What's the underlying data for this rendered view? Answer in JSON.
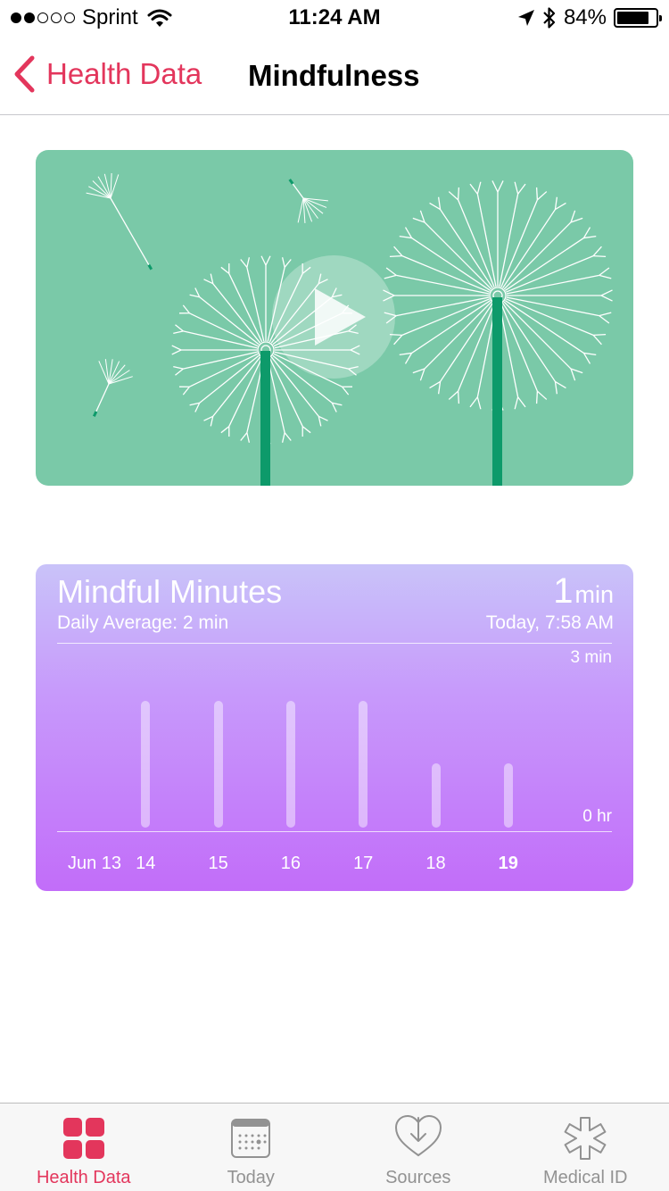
{
  "status_bar": {
    "carrier": "Sprint",
    "time": "11:24 AM",
    "battery": "84%",
    "battery_level": 0.84,
    "signal_filled": 2,
    "signal_total": 5
  },
  "nav": {
    "back_label": "Health Data",
    "title": "Mindfulness"
  },
  "colors": {
    "accent": "#e3365c",
    "video_bg": "#7ac9a8",
    "stem": "#0d9a6a"
  },
  "chart_card": {
    "title": "Mindful Minutes",
    "subtitle": "Daily Average: 2 min",
    "latest_value": "1",
    "latest_unit": "min",
    "latest_time": "Today, 7:58 AM"
  },
  "chart_data": {
    "type": "bar",
    "categories": [
      "Jun 13",
      "14",
      "15",
      "16",
      "17",
      "18",
      "19"
    ],
    "values": [
      0,
      2,
      2,
      2,
      2,
      1,
      1
    ],
    "y_max_label": "3 min",
    "y_min_label": "0 hr",
    "ylim": [
      0,
      3
    ],
    "highlighted_category": "19"
  },
  "tabs": [
    {
      "label": "Health Data",
      "icon": "health-data-icon",
      "active": true
    },
    {
      "label": "Today",
      "icon": "calendar-icon",
      "active": false
    },
    {
      "label": "Sources",
      "icon": "sources-heart-icon",
      "active": false
    },
    {
      "label": "Medical ID",
      "icon": "medical-id-icon",
      "active": false
    }
  ]
}
